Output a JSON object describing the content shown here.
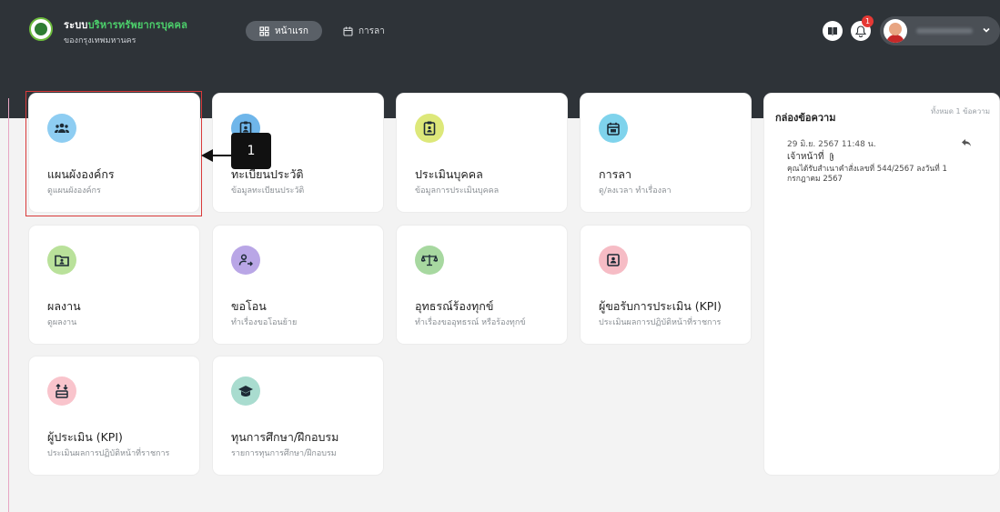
{
  "header": {
    "brand_main_prefix": "ระบบ",
    "brand_main_accent": "บริหารทรัพยากรบุคคล",
    "brand_sub": "ของกรุงเทพมหานคร",
    "nav": [
      {
        "label": "หน้าแรก",
        "icon": "grid-icon",
        "active": true
      },
      {
        "label": "การลา",
        "icon": "calendar-icon",
        "active": false
      }
    ],
    "notification_count": "1",
    "colors": {
      "bar": "#2e3338",
      "accent": "#4cd06b",
      "badge": "#e53935"
    }
  },
  "cards": [
    {
      "title": "แผนผังองค์กร",
      "subtitle": "ดูแผนผังองค์กร",
      "icon": "people-group-icon",
      "color": "#8ecdf2"
    },
    {
      "title": "ทะเบียนประวัติ",
      "subtitle": "ข้อมูลทะเบียนประวัติ",
      "icon": "id-badge-icon",
      "color": "#6fb6ea"
    },
    {
      "title": "ประเมินบุคคล",
      "subtitle": "ข้อมูลการประเมินบุคคล",
      "icon": "clipboard-icon",
      "color": "#dde87a"
    },
    {
      "title": "การลา",
      "subtitle": "ดู/ลงเวลา ทำเรื่องลา",
      "icon": "calendar-icon",
      "color": "#7fd3ec"
    },
    {
      "title": "ผลงาน",
      "subtitle": "ดูผลงาน",
      "icon": "folder-user-icon",
      "color": "#b9e19a"
    },
    {
      "title": "ขอโอน",
      "subtitle": "ทำเรื่องขอโอนย้าย",
      "icon": "user-transfer-icon",
      "color": "#b9a6e6"
    },
    {
      "title": "อุทธรณ์ร้องทุกข์",
      "subtitle": "ทำเรื่องขออุทธรณ์ หรือร้องทุกข์",
      "icon": "scales-icon",
      "color": "#a7d8a0"
    },
    {
      "title": "ผู้ขอรับการประเมิน (KPI)",
      "subtitle": "ประเมินผลการปฏิบัติหน้าที่ราชการ",
      "icon": "user-square-icon",
      "color": "#f6bcc5"
    },
    {
      "title": "ผู้ประเมิน (KPI)",
      "subtitle": "ประเมินผลการปฏิบัติหน้าที่ราชการ",
      "icon": "sort-users-icon",
      "color": "#f9c4cc"
    },
    {
      "title": "ทุนการศึกษา/ฝึกอบรม",
      "subtitle": "รายการทุนการศึกษา/ฝึกอบรม",
      "icon": "graduation-cap-icon",
      "color": "#a9dccf"
    }
  ],
  "callout": {
    "label": "1"
  },
  "inbox": {
    "title": "กล่องข้อความ",
    "count_text": "ทั้งหมด 1 ข้อความ",
    "messages": [
      {
        "date": "29 มิ.ย. 2567 11:48 น.",
        "from": "เจ้าหน้าที่",
        "body": "คุณได้รับสำเนาคำสั่งเลขที่ 544/2567 ลงวันที่ 1 กรกฎาคม 2567"
      }
    ]
  }
}
